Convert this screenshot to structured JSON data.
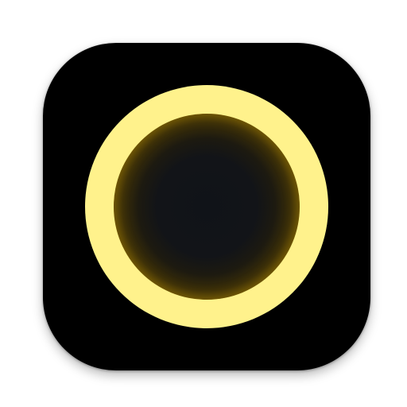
{
  "icon": {
    "name": "circle-glow-app-icon",
    "colors": {
      "background": "#000000",
      "ring": "#fff28c",
      "glow": "#d9b200",
      "center": "#111418"
    }
  }
}
